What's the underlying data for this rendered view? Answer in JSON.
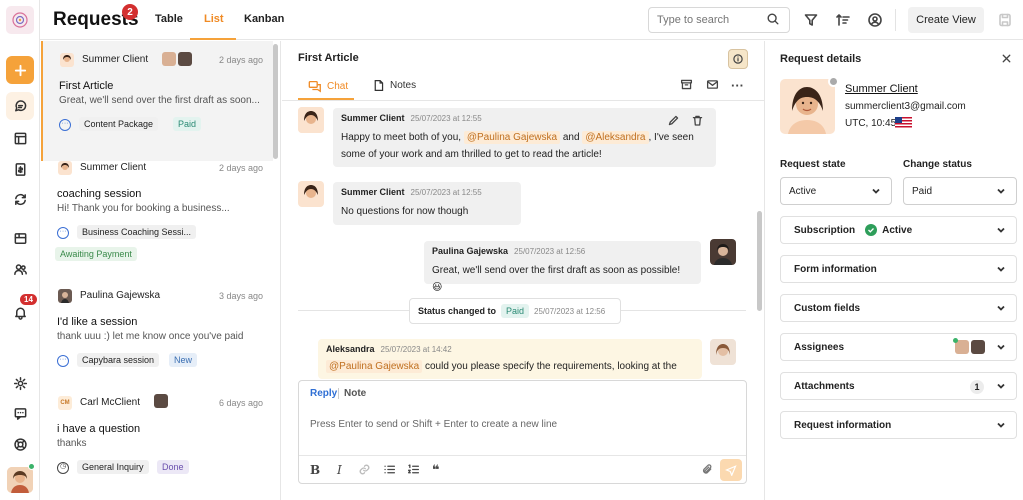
{
  "header": {
    "title": "Requests",
    "title_badge": "2",
    "tabs": [
      {
        "label": "Table",
        "active": false
      },
      {
        "label": "List",
        "active": true
      },
      {
        "label": "Kanban",
        "active": false
      }
    ],
    "search_placeholder": "Type to search",
    "create_view_label": "Create View"
  },
  "sidebar": {
    "notification_count": "14",
    "accent_color": "#f5a23a"
  },
  "list": {
    "items": [
      {
        "name": "Summer Client",
        "time": "2 days ago",
        "subject": "First Article",
        "preview": "Great, we'll send over the first draft as soon...",
        "type": "Content Package",
        "status": "Paid"
      },
      {
        "name": "Summer Client",
        "time": "2 days ago",
        "subject": "coaching session",
        "preview": "Hi! Thank you for booking a business...",
        "type": "Business Coaching Sessi...",
        "status": "Awaiting Payment"
      },
      {
        "name": "Paulina Gajewska",
        "time": "3 days ago",
        "subject": "I'd like a session",
        "preview": "thank uuu :) let me know once you've paid",
        "type": "Capybara session",
        "status": "New"
      },
      {
        "name": "Carl McClient",
        "initials": "CM",
        "time": "6 days ago",
        "subject": "i have a question",
        "preview": "thanks",
        "type": "General Inquiry",
        "status": "Done"
      }
    ]
  },
  "chat": {
    "title": "First Article",
    "tabs": {
      "chat": "Chat",
      "notes": "Notes"
    },
    "messages": [
      {
        "author": "Summer Client",
        "time": "25/07/2023 at 12:55",
        "text_before": "Happy to meet both of you,",
        "mention1": "@Paulina Gajewska",
        "and": "and",
        "mention2": "@Aleksandra",
        "text_after": ", I've seen",
        "text_line2": "some of your work and am thrilled to get to read the article!"
      },
      {
        "author": "Summer Client",
        "time": "25/07/2023 at 12:55",
        "text": "No questions for now though"
      },
      {
        "author": "Paulina Gajewska",
        "time": "25/07/2023 at 12:56",
        "text": "Great, we'll send over the first draft as soon as possible! 😃"
      },
      {
        "author": "Aleksandra",
        "time": "25/07/2023 at 14:42",
        "mention": "@Paulina Gajewska",
        "text": "could you please specify the requirements, looking at the"
      }
    ],
    "status_change": {
      "label": "Status changed to",
      "value": "Paid",
      "time": "25/07/2023 at 12:56"
    },
    "composer": {
      "reply": "Reply",
      "note": "Note",
      "placeholder": "Press Enter to send or Shift + Enter to create a new line"
    }
  },
  "details": {
    "title": "Request details",
    "client_name": "Summer Client",
    "client_email": "summerclient3@gmail.com",
    "client_time": "UTC, 10:45",
    "request_state_label": "Request state",
    "request_state_value": "Active",
    "change_status_label": "Change status",
    "change_status_value": "Paid",
    "sections": {
      "subscription": "Subscription",
      "subscription_status": "Active",
      "form_information": "Form information",
      "custom_fields": "Custom fields",
      "assignees": "Assignees",
      "attachments": "Attachments",
      "attachments_count": "1",
      "request_information": "Request information"
    }
  }
}
